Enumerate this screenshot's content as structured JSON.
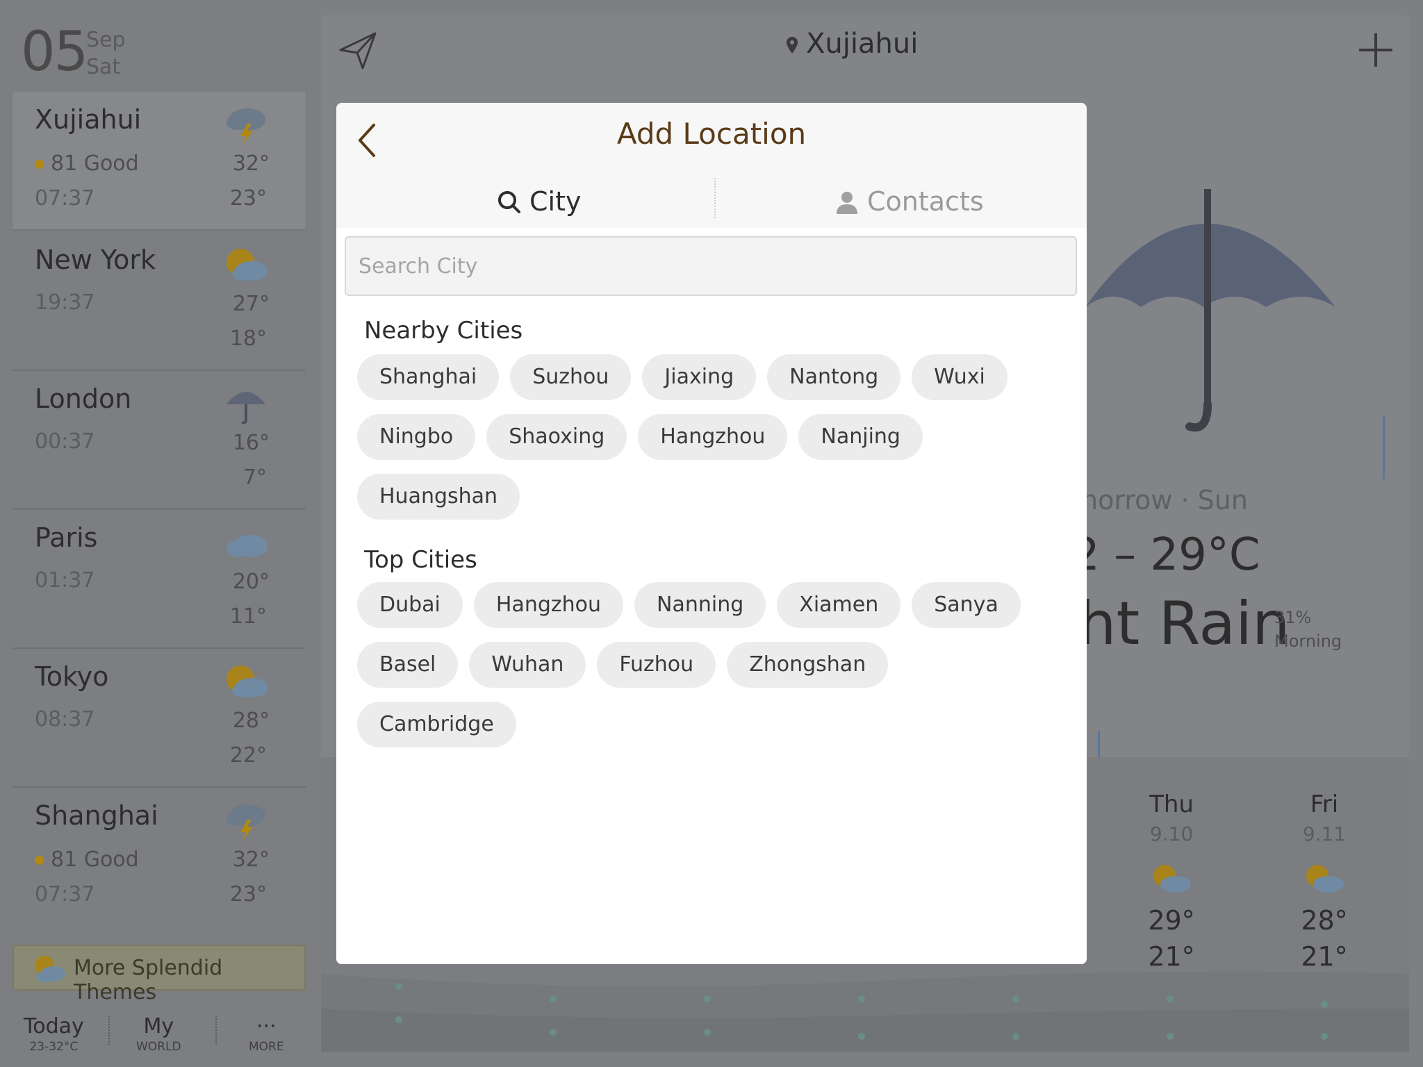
{
  "sidebar": {
    "date_day": "05",
    "date_month": "Sep",
    "date_weekday": "Sat",
    "cities": [
      {
        "name": "Xujiahui",
        "aqi": "81 Good",
        "time": "07:37",
        "hi": "32°",
        "lo": "23°",
        "icon": "thunderstorm-icon"
      },
      {
        "name": "New York",
        "time": "19:37",
        "hi": "27°",
        "lo": "18°",
        "icon": "partly-cloudy-icon"
      },
      {
        "name": "London",
        "time": "00:37",
        "hi": "16°",
        "lo": "7°",
        "icon": "umbrella-icon"
      },
      {
        "name": "Paris",
        "time": "01:37",
        "hi": "20°",
        "lo": "11°",
        "icon": "cloud-icon"
      },
      {
        "name": "Tokyo",
        "time": "08:37",
        "hi": "28°",
        "lo": "22°",
        "icon": "partly-cloudy-icon"
      },
      {
        "name": "Shanghai",
        "aqi": "81 Good",
        "time": "07:37",
        "hi": "32°",
        "lo": "23°",
        "icon": "thunderstorm-icon"
      }
    ],
    "themes_label": "More Splendid Themes",
    "nav": {
      "today": "Today",
      "today_sub": "23-32°C",
      "my": "My",
      "my_sub": "WORLD",
      "more_dots": "···",
      "more_sub": "MORE"
    }
  },
  "main": {
    "location": "Xujiahui",
    "tomorrow_text": "norrow · Sun",
    "temp_range": "2 – 29°C",
    "condition": "ht Rain",
    "precip_pct": "31%",
    "precip_when": "Morning",
    "forecast": [
      {
        "day": "Thu",
        "date": "9.10",
        "hi": "29°",
        "lo": "21°"
      },
      {
        "day": "Fri",
        "date": "9.11",
        "hi": "28°",
        "lo": "21°"
      }
    ]
  },
  "modal": {
    "title": "Add Location",
    "tab_city": "City",
    "tab_contacts": "Contacts",
    "search_placeholder": "Search City",
    "nearby_title": "Nearby Cities",
    "nearby": [
      "Shanghai",
      "Suzhou",
      "Jiaxing",
      "Nantong",
      "Wuxi",
      "Ningbo",
      "Shaoxing",
      "Hangzhou",
      "Nanjing",
      "Huangshan"
    ],
    "top_title": "Top Cities",
    "top": [
      "Dubai",
      "Hangzhou",
      "Nanning",
      "Xiamen",
      "Sanya",
      "Basel",
      "Wuhan",
      "Fuzhou",
      "Zhongshan",
      "Cambridge"
    ]
  },
  "colors": {
    "accent_brown": "#5a3b18",
    "aqi_dot": "#b28a12",
    "chip_bg": "#ececec"
  }
}
